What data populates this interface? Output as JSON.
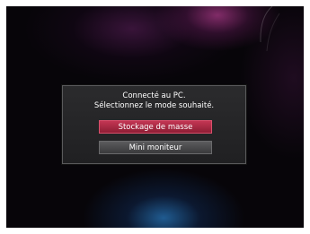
{
  "dialog": {
    "message_line1": "Connecté au PC.",
    "message_line2": "Sélectionnez le mode souhaité.",
    "options": [
      {
        "label": "Stockage de masse",
        "selected": true
      },
      {
        "label": "Mini moniteur",
        "selected": false
      }
    ]
  },
  "colors": {
    "selected_option": "#b02a47",
    "normal_option": "#4a4a4c",
    "dialog_background": "#262628",
    "screen_background": "#070509"
  }
}
